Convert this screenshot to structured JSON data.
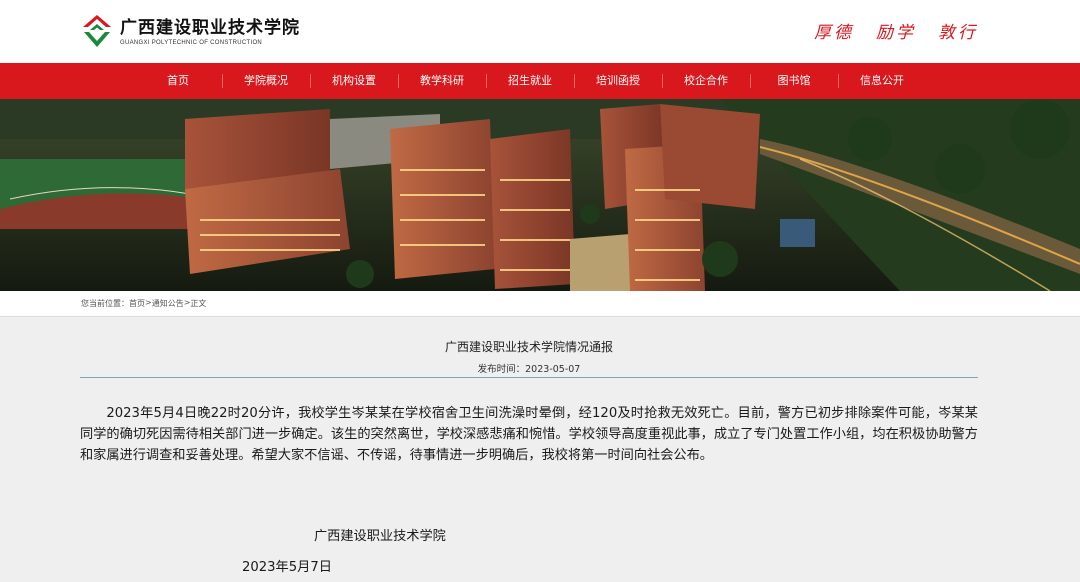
{
  "header": {
    "logo_cn": "广西建设职业技术学院",
    "logo_en": "GUANGXI POLYTECHNIC OF CONSTRUCTION",
    "motto": [
      "厚德",
      "励学",
      "敦行"
    ],
    "colors": {
      "brand_red": "#d9181e",
      "logo_green": "#1a8a3a"
    }
  },
  "nav": {
    "items": [
      "首页",
      "学院概况",
      "机构设置",
      "教学科研",
      "招生就业",
      "培训函授",
      "校企合作",
      "图书馆",
      "信息公开"
    ]
  },
  "breadcrumb": {
    "prefix": "您当前位置：",
    "items": [
      "首页",
      "通知公告",
      "正文"
    ],
    "separator": ">"
  },
  "article": {
    "title": "广西建设职业技术学院情况通报",
    "date_label": "发布时间：2023-05-07",
    "body": "2023年5月4日晚22时20分许，我校学生岑某某在学校宿舍卫生间洗澡时晕倒，经120及时抢救无效死亡。目前，警方已初步排除案件可能，岑某某同学的确切死因需待相关部门进一步确定。该生的突然离世，学校深感悲痛和惋惜。学校领导高度重视此事，成立了专门处置工作小组，均在积极协助警方和家属进行调查和妥善处理。希望大家不信谣、不传谣，待事情进一步明确后，我校将第一时间向社会公布。",
    "signature_org": "广西建设职业技术学院",
    "signature_date": "2023年5月7日"
  }
}
